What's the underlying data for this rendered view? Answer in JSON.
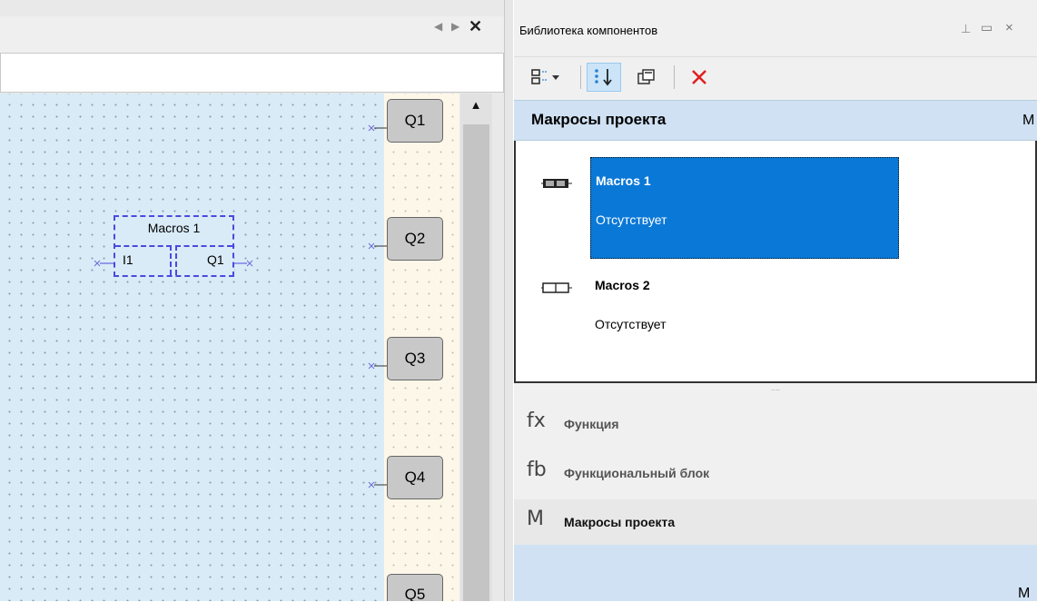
{
  "editor": {
    "tab_nav_left": "◀",
    "tab_nav_right": "▶",
    "tab_close": "✕",
    "scroll_up": "▲",
    "outputs": [
      "Q1",
      "Q2",
      "Q3",
      "Q4",
      "Q5"
    ],
    "macro_block": {
      "title": "Macros 1",
      "input": "I1",
      "output": "Q1"
    }
  },
  "library": {
    "title": "Библиотека компонентов",
    "pin_icon": "⊥",
    "max_icon": "▭",
    "close_icon": "×",
    "toolbar": {
      "view_icon": "☷▾",
      "sort_icon": "⁞↓",
      "copy_icon": "⧉",
      "delete_icon": "✕"
    },
    "section": {
      "title": "Макросы проекта",
      "letter": "M"
    },
    "items": [
      {
        "name": "Macros 1",
        "status": "Отсутствует",
        "selected": true
      },
      {
        "name": "Macros 2",
        "status": "Отсутствует",
        "selected": false
      }
    ],
    "splitter": "....",
    "nav": [
      {
        "icon": "fx",
        "label": "Функция"
      },
      {
        "icon": "fb",
        "label": "Функциональный блок"
      },
      {
        "icon": "M",
        "label": "Макросы проекта"
      }
    ],
    "bottom_letter": "M"
  },
  "colors": {
    "canvas": "#d9ebf7",
    "selection": "#0a78d7",
    "macro_border": "#4a4adf",
    "delete_red": "#e02020"
  }
}
